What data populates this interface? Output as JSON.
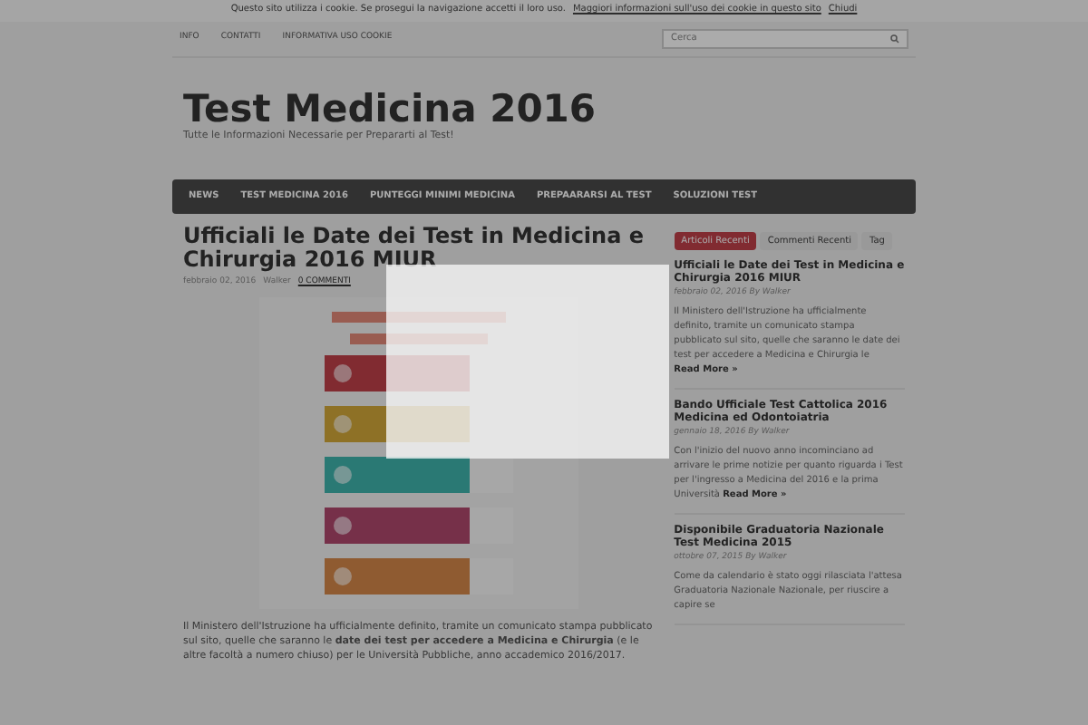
{
  "cookie_bar": {
    "text": "Questo sito utilizza i cookie. Se prosegui la navigazione accetti il loro uso.",
    "link": "Maggiori informazioni sull'uso dei cookie in questo sito",
    "close": "Chiudi"
  },
  "top_menu": [
    "INFO",
    "CONTATTI",
    "INFORMATIVA USO COOKIE"
  ],
  "search": {
    "placeholder": "Cerca"
  },
  "header": {
    "title": "Test Medicina 2016",
    "tagline": "Tutte le Informazioni Necessarie per Prepararti al Test!"
  },
  "main_nav": [
    "NEWS",
    "TEST MEDICINA 2016",
    "PUNTEGGI MINIMI MEDICINA",
    "PREPAARARSI AL TEST",
    "SOLUZIONI TEST"
  ],
  "article": {
    "title": "Ufficiali le Date dei Test in Medicina e Chirurgia 2016 MIUR",
    "date": "febbraio 02, 2016",
    "author": "Walker",
    "comments": "0 COMMENTI",
    "body": "Il Ministero dell'Istruzione ha ufficialmente definito, tramite un comunicato stampa pubblicato sul sito, quelle che saranno le **date dei test per accedere a Medicina e Chirurgia** (e le altre facoltà a numero chiuso) per le Università Pubbliche, anno accademico 2016/2017."
  },
  "sidebar": {
    "tabs": [
      {
        "label": "Articoli Recenti",
        "selected": true
      },
      {
        "label": "Commenti Recenti",
        "selected": false
      },
      {
        "label": "Tag",
        "selected": false
      }
    ],
    "posts": [
      {
        "title": "Ufficiali le Date dei Test in Medicina e Chirurgia 2016 MIUR",
        "meta": "febbraio 02, 2016 By Walker",
        "excerpt": "Il Ministero dell'Istruzione ha ufficialmente definito, tramite un comunicato stampa pubblicato sul sito, quelle che saranno le date dei test per accedere a Medicina e Chirurgia le",
        "more": "Read More »"
      },
      {
        "title": "Bando Ufficiale Test Cattolica 2016 Medicina ed Odontoiatria",
        "meta": "gennaio 18, 2016 By Walker",
        "excerpt": "Con l'inizio del nuovo anno incominciano ad arrivare le prime notizie per quanto riguarda i Test per l'ingresso a Medicina del 2016 e la prima Università",
        "more": "Read More »"
      },
      {
        "title": "Disponibile Graduatoria Nazionale Test Medicina 2015",
        "meta": "ottobre 07, 2015 By Walker",
        "excerpt": "Come da calendario è stato oggi rilasciata l'attesa Graduatoria Nazionale Nazionale, per riuscire a capire se"
      }
    ]
  }
}
